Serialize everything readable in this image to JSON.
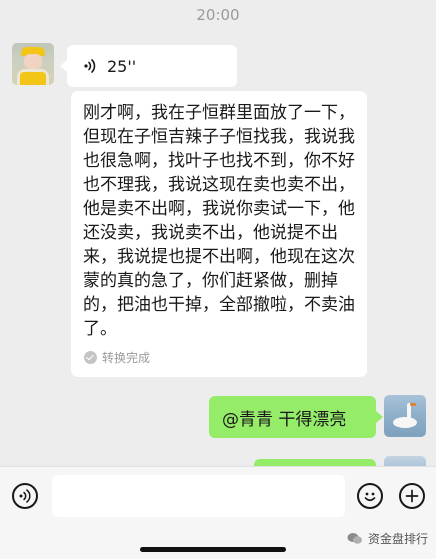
{
  "status_bar": {
    "time": "20:00"
  },
  "messages": [
    {
      "type": "voice",
      "sender": "other",
      "duration": "25''"
    },
    {
      "type": "transcript",
      "sender": "other",
      "text": "刚才啊，我在子恒群里面放了一下，但现在子恒吉辣子子恒找我，我说我也很急啊，找叶子也找不到，你不好也不理我，我说这现在卖也卖不出，他是卖不出啊，我说你卖试一下，他还没卖，我说卖不出，他说提不出来，我说提也提不出啊，他现在这次蒙的真的急了，你们赶紧做，删掉的，把油也干掉，全部撤啦，不卖油了。",
      "status": "转换完成"
    },
    {
      "type": "text",
      "sender": "self",
      "text": "@青青 干得漂亮"
    }
  ],
  "input_bar": {
    "placeholder": ""
  },
  "icons": {
    "voice_toggle": "voice-wave-icon",
    "emoji": "emoji-icon",
    "more": "plus-icon"
  },
  "watermark": {
    "text": "资金盘排行"
  },
  "colors": {
    "self_bubble": "#95ec69",
    "other_bubble": "#ffffff",
    "background": "#ededed"
  }
}
